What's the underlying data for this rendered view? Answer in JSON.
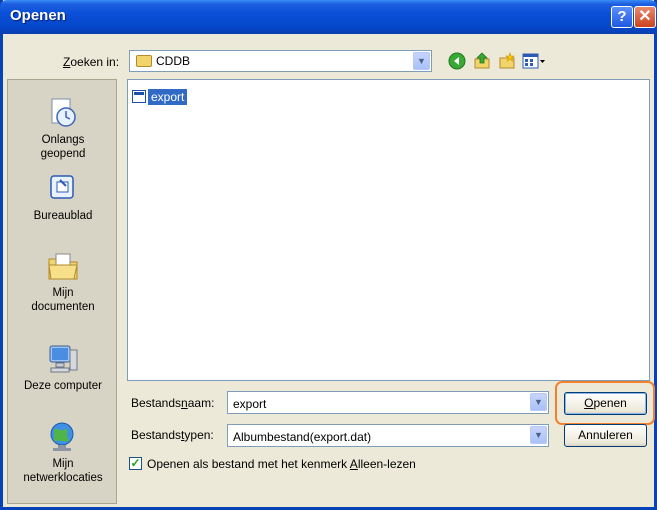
{
  "window": {
    "title": "Openen"
  },
  "titlebar": {
    "help_glyph": "?",
    "close_glyph": "✕"
  },
  "lookin": {
    "label_underline": "Z",
    "label_rest": "oeken in:",
    "value": "CDDB",
    "icon": "folder-icon"
  },
  "toolbar": {
    "back_icon": "back-icon",
    "up_icon": "up-folder-icon",
    "new_folder_icon": "new-folder-icon",
    "view_icon": "view-menu-icon"
  },
  "places": [
    {
      "line1": "Onlangs",
      "line2": "geopend",
      "icon": "recent-icon"
    },
    {
      "line1": "Bureaublad",
      "line2": "",
      "icon": "desktop-icon"
    },
    {
      "line1": "Mijn",
      "line2": "documenten",
      "icon": "my-documents-icon"
    },
    {
      "line1": "Deze computer",
      "line2": "",
      "icon": "my-computer-icon"
    },
    {
      "line1": "Mijn",
      "line2": "netwerklocaties",
      "icon": "network-icon"
    }
  ],
  "files": [
    {
      "name": "export",
      "selected": true,
      "icon": "file-icon"
    }
  ],
  "filename": {
    "label_before": "Bestands",
    "label_underline": "n",
    "label_after": "aam:",
    "value": "export"
  },
  "filetype": {
    "label_before": "Bestands",
    "label_underline": "t",
    "label_after": "ypen:",
    "value": "Albumbestand(export.dat)"
  },
  "buttons": {
    "open_underline": "O",
    "open_rest": "penen",
    "cancel": "Annuleren"
  },
  "readonly": {
    "checked": true,
    "label_before": "Openen als bestand met het kenmerk ",
    "label_underline": "A",
    "label_after": "lleen-lezen"
  },
  "colors": {
    "titlebar": "#0a4fd8",
    "selection": "#316ac5",
    "highlight": "#f2802c"
  }
}
